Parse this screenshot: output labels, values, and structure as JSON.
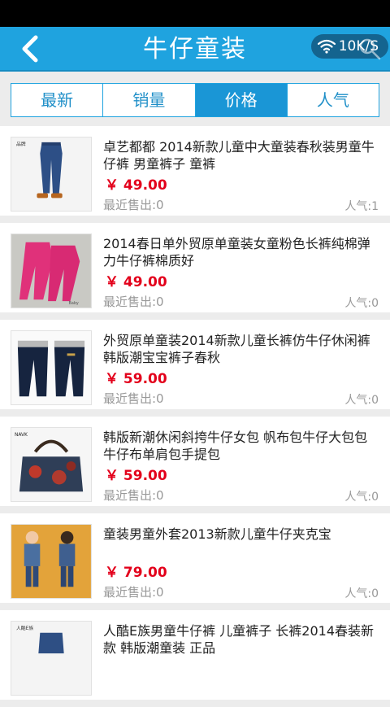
{
  "header": {
    "title": "牛仔童装",
    "back_icon": "chevron-left-icon",
    "network_speed": "10K/S",
    "search_icon": "search-icon"
  },
  "tabs": [
    {
      "label": "最新",
      "active": false
    },
    {
      "label": "销量",
      "active": false
    },
    {
      "label": "价格",
      "active": true
    },
    {
      "label": "人气",
      "active": false
    }
  ],
  "products": [
    {
      "title": "卓艺都都 2014新款儿童中大童装春秋装男童牛仔裤 男童裤子 童裤",
      "price": "￥ 49.00",
      "sold": "最近售出:0",
      "popularity": "人气:1"
    },
    {
      "title": "2014春日单外贸原单童装女童粉色长裤纯棉弹力牛仔裤棉质好",
      "price": "￥ 49.00",
      "sold": "最近售出:0",
      "popularity": "人气:0"
    },
    {
      "title": "外贸原单童装2014新款儿童长裤仿牛仔休闲裤韩版潮宝宝裤子春秋",
      "price": "￥ 59.00",
      "sold": "最近售出:0",
      "popularity": "人气:0"
    },
    {
      "title": "韩版新潮休闲斜挎牛仔女包 帆布包牛仔大包包 牛仔布单肩包手提包",
      "price": "￥ 59.00",
      "sold": "最近售出:0",
      "popularity": "人气:0"
    },
    {
      "title": "童装男童外套2013新款儿童牛仔夹克宝",
      "price": "￥ 79.00",
      "sold": "最近售出:0",
      "popularity": "人气:0"
    },
    {
      "title": "人酷E族男童牛仔裤 儿童裤子 长裤2014春装新款 韩版潮童装 正品",
      "price": "",
      "sold": "",
      "popularity": ""
    }
  ],
  "colors": {
    "header": "#1fa3df",
    "tab_active": "#1a96d6",
    "price": "#e3001b"
  }
}
